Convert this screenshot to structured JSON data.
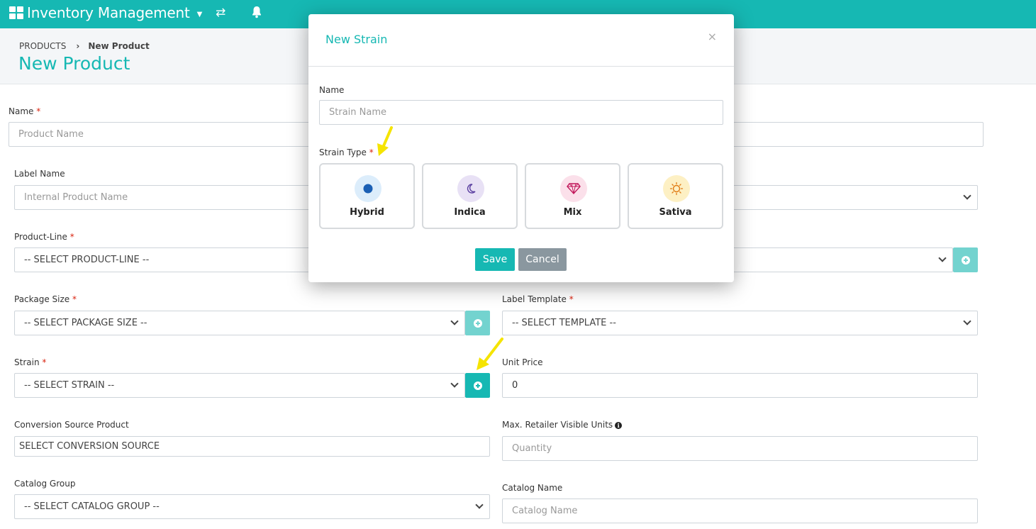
{
  "app": {
    "title": "Inventory Management",
    "colors": {
      "accent": "#16b8b3",
      "required": "#d9230f",
      "highlight_arrow": "#f5e400"
    }
  },
  "topbar": {
    "icons": [
      "apps-grid-icon",
      "caret-down-icon",
      "swap-arrows-icon",
      "bell-icon"
    ]
  },
  "breadcrumb": {
    "root": "PRODUCTS",
    "separator": "›",
    "current": "New Product"
  },
  "page": {
    "title": "New Product"
  },
  "form": {
    "name": {
      "label": "Name",
      "placeholder": "Product Name"
    },
    "label_name": {
      "label": "Label Name",
      "placeholder": "Internal Product Name"
    },
    "product_line": {
      "label": "Product-Line",
      "value": "-- SELECT PRODUCT-LINE --"
    },
    "package_size": {
      "label": "Package Size",
      "value": "-- SELECT PACKAGE SIZE --"
    },
    "label_template": {
      "label": "Label Template",
      "value": "-- SELECT TEMPLATE --"
    },
    "strain": {
      "label": "Strain",
      "value": "-- SELECT STRAIN --"
    },
    "unit_price": {
      "label": "Unit Price",
      "value": "0"
    },
    "conversion_source": {
      "label": "Conversion Source Product",
      "value": "SELECT CONVERSION SOURCE"
    },
    "max_retailer_units": {
      "label": "Max. Retailer Visible Units",
      "placeholder": "Quantity"
    },
    "catalog_group": {
      "label": "Catalog Group",
      "value": "-- SELECT CATALOG GROUP --"
    },
    "catalog_name": {
      "label": "Catalog Name",
      "placeholder": "Catalog Name"
    },
    "required_mark": "*"
  },
  "modal": {
    "title": "New Strain",
    "close": "×",
    "name_label": "Name",
    "name_placeholder": "Strain Name",
    "strain_type_label": "Strain Type",
    "required_mark": "*",
    "strain_types": [
      {
        "label": "Hybrid",
        "icon": "circle-icon",
        "color": "#1a5fb4",
        "bg": "#dcedfb"
      },
      {
        "label": "Indica",
        "icon": "moon-icon",
        "color": "#5a3fa0",
        "bg": "#e8e1f5"
      },
      {
        "label": "Mix",
        "icon": "diamond-icon",
        "color": "#c2185b",
        "bg": "#fbe0ea"
      },
      {
        "label": "Sativa",
        "icon": "sun-icon",
        "color": "#e07a12",
        "bg": "#fdf0c4"
      }
    ],
    "save_label": "Save",
    "cancel_label": "Cancel"
  }
}
